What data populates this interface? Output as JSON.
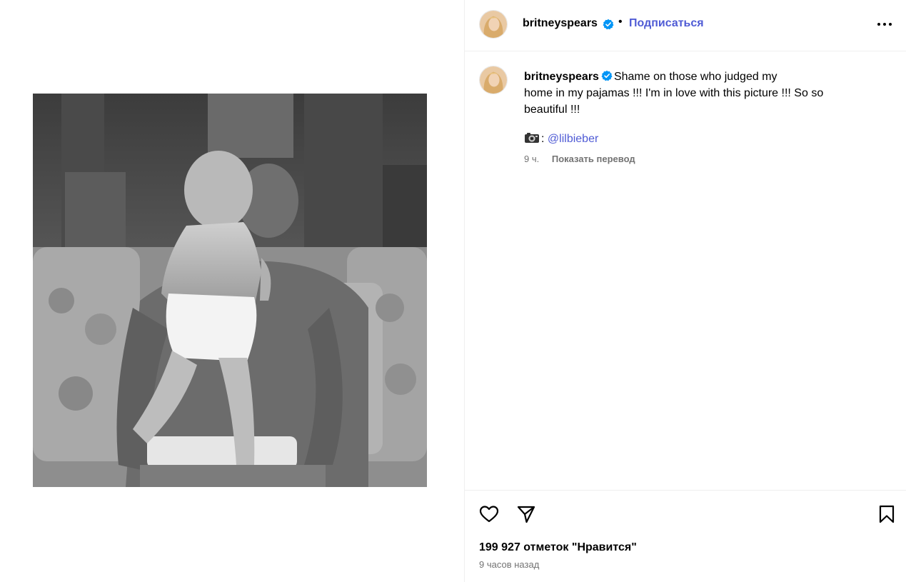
{
  "post": {
    "username": "britneyspears",
    "follow_label": "Подписаться",
    "dot": "•",
    "caption_text": "Shame on those who judged my\nhome in my pajamas !!! I'm in love with this picture !!! So so beautiful !!!",
    "mention_suffix": ":",
    "mention": "@lilbieber",
    "time_short": "9 ч.",
    "translate_label": "Показать перевод",
    "likes_text": "199 927 отметок \"Нравится\"",
    "posted_ago": "9 часов назад"
  },
  "icons": {
    "verified": "verified-badge-icon",
    "more": "more-options-icon",
    "camera": "camera-emoji-icon",
    "like": "heart-icon",
    "share": "paper-plane-icon",
    "save": "bookmark-icon"
  },
  "colors": {
    "link": "#4f5bd5",
    "verified": "#0095f6",
    "muted": "#737373",
    "border": "#efefef"
  }
}
